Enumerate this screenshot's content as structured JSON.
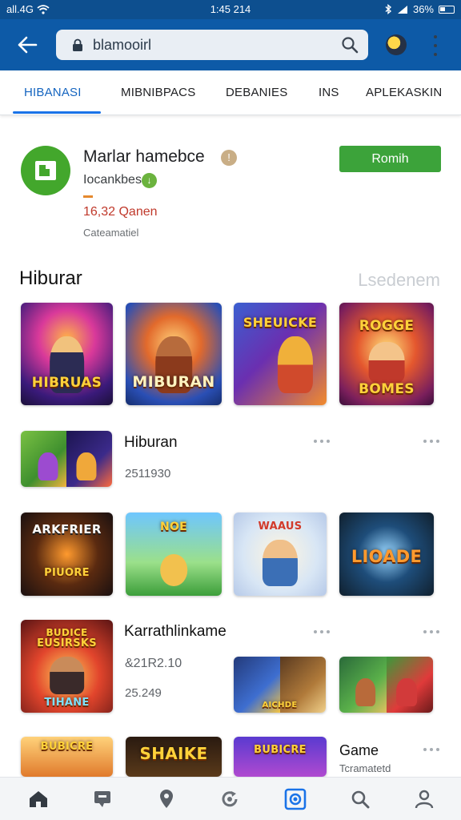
{
  "status_bar": {
    "carrier": "all.4G",
    "time": "1:45 214",
    "battery": "36%"
  },
  "app_bar": {
    "search_query": "blamooirl"
  },
  "tabs": [
    {
      "label": "HIBANASI"
    },
    {
      "label": "MIBNIBPACS"
    },
    {
      "label": "DEBANIES"
    },
    {
      "label": "INS"
    },
    {
      "label": "APLEKASKIN"
    }
  ],
  "featured": {
    "title": "Marlar hamebce",
    "developer": "Iocankbes",
    "games_count": "16,32 Qanen",
    "subtitle": "Cateamatiel",
    "install_label": "Romih",
    "icon_color": "#43a72c",
    "button_color": "#3ca33a"
  },
  "section": {
    "title": "Hiburar",
    "link": "Lsedenem"
  },
  "tile_labels": {
    "t1": "HIBRUAS",
    "t2": "MIBURAN",
    "t3": "SHEUICKE",
    "t4": "BOMES",
    "t4b": "ROGGE",
    "t5": "ARKFRIER",
    "t5b": "PIUORE",
    "t6": "NOE",
    "t7": "WAAUS",
    "t8": "LIOADE",
    "t9": "BUDICE",
    "t9b": "EUSIRSKS",
    "t9c": "TIHANE",
    "t10": "AICHDE",
    "t11": "SHAIKE",
    "t12": "BUBICRE"
  },
  "rows": [
    {
      "title": "Hiburan",
      "meta": "2511930"
    },
    {
      "title": "Karrathlinkame",
      "meta": "&21R2.10",
      "meta2": "25.249"
    },
    {
      "title": "Game",
      "meta": "Tcramatetd"
    }
  ],
  "nav_icons": [
    "home-icon",
    "chat-icon",
    "map-pin-icon",
    "refresh-icon",
    "camera-icon",
    "search-icon",
    "profile-icon"
  ],
  "colors": {
    "app_bar": "#0d5aa7",
    "accent": "#1a73e8",
    "install": "#3ca33a"
  }
}
